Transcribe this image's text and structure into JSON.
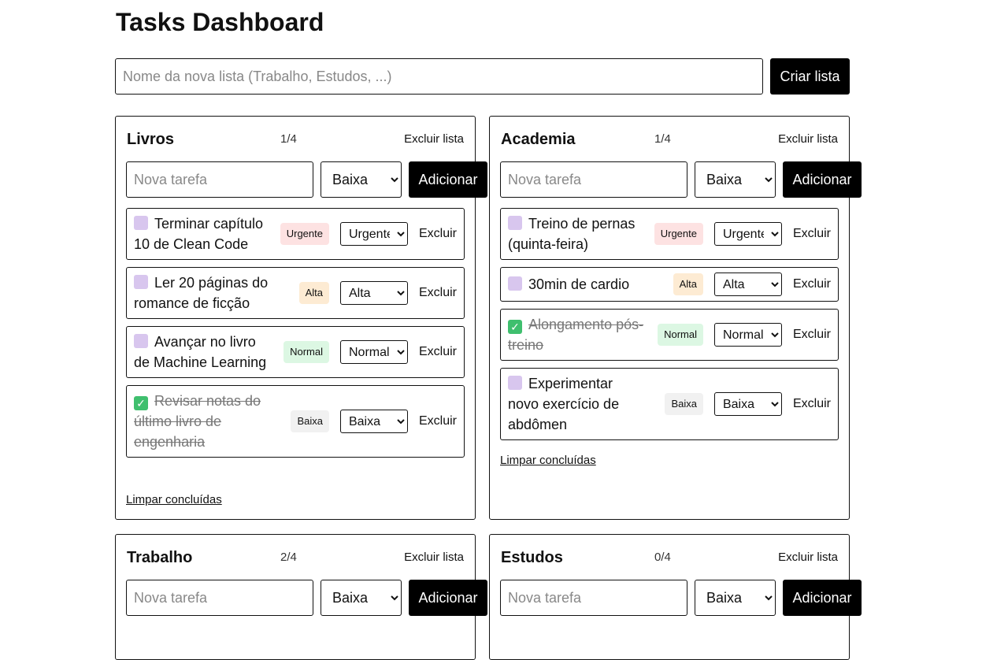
{
  "page": {
    "title": "Tasks Dashboard"
  },
  "new_list": {
    "placeholder": "Nome da nova lista (Trabalho, Estudos, ...)",
    "button": "Criar lista"
  },
  "common": {
    "task_placeholder": "Nova tarefa",
    "default_priority": "Baixa",
    "add_button": "Adicionar",
    "delete_list": "Excluir lista",
    "delete_task": "Excluir",
    "clear_done": "Limpar concluídas",
    "priority_options": [
      "Baixa",
      "Normal",
      "Alta",
      "Urgente"
    ]
  },
  "priority_colors": {
    "Urgente": "#fde2e2",
    "Alta": "#fdebd3",
    "Normal": "#dcf7e3",
    "Baixa": "#f1f1f1"
  },
  "lists": [
    {
      "name": "Livros",
      "count": "1/4",
      "tasks": [
        {
          "text": "Terminar capítulo 10 de Clean Code",
          "priority": "Urgente",
          "done": false
        },
        {
          "text": "Ler 20 páginas do romance de ficção",
          "priority": "Alta",
          "done": false
        },
        {
          "text": "Avançar no livro de Machine Learning",
          "priority": "Normal",
          "done": false
        },
        {
          "text": "Revisar notas do último livro de engenharia",
          "priority": "Baixa",
          "done": true
        }
      ]
    },
    {
      "name": "Academia",
      "count": "1/4",
      "tasks": [
        {
          "text": "Treino de pernas (quinta-feira)",
          "priority": "Urgente",
          "done": false
        },
        {
          "text": "30min de cardio",
          "priority": "Alta",
          "done": false
        },
        {
          "text": "Alongamento pós-treino",
          "priority": "Normal",
          "done": true
        },
        {
          "text": "Experimentar novo exercício de abdômen",
          "priority": "Baixa",
          "done": false
        }
      ]
    },
    {
      "name": "Trabalho",
      "count": "2/4",
      "tasks": []
    },
    {
      "name": "Estudos",
      "count": "0/4",
      "tasks": []
    }
  ]
}
